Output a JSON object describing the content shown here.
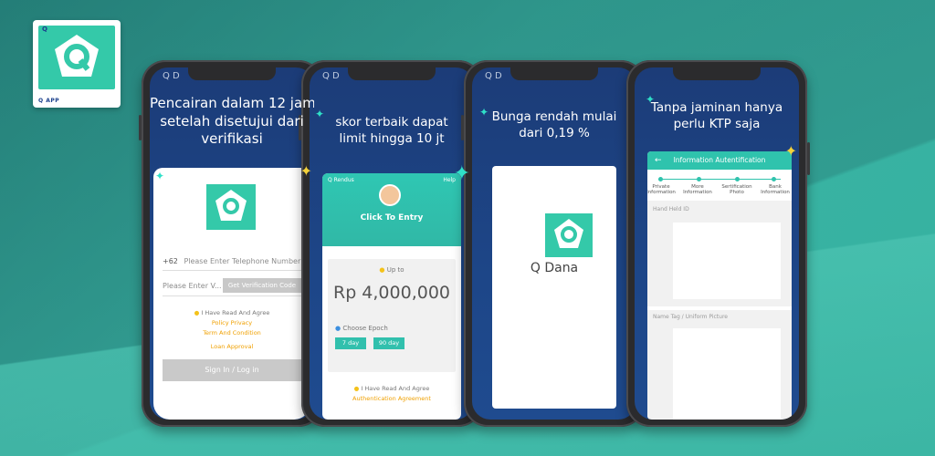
{
  "app_icon": {
    "mini_label": "Q",
    "footer_label": "Q APP"
  },
  "colors": {
    "teal": "#34c9a9",
    "navy": "#1c3c78",
    "star_cyan": "#2fe0c8",
    "star_yellow": "#f4d23a",
    "link_orange": "#f0a000"
  },
  "phone1": {
    "topmark": "Q D",
    "headline_line1": "Pencairan dalam 12 jam",
    "headline_line2": "setelah disetujui dari",
    "headline_line3": "verifikasi",
    "phone_prefix": "+62",
    "phone_placeholder": "Please Enter Telephone Number",
    "code_placeholder": "Please Enter V...",
    "code_button": "Get Verification Code",
    "agree": "I Have Read And Agree",
    "policy_link": "Policy Privacy",
    "terms_link": "Term And Condition",
    "loan_link": "Loan Approval",
    "login_button": "Sign In / Log in"
  },
  "phone2": {
    "topmark": "Q D",
    "headline_line1": "skor terbaik dapat",
    "headline_line2": "limit hingga 10 jt",
    "header_left": "Q Rendus",
    "header_right": "Help",
    "entry_label": "Click To Entry",
    "up_to": "Up to",
    "amount": "Rp 4,000,000",
    "epoch_label": "Choose Epoch",
    "chips": [
      "7 day",
      "90 day"
    ],
    "agree": "I Have Read And Agree",
    "agreement_link": "Authentication Agreement"
  },
  "phone3": {
    "topmark": "Q D",
    "headline_line1": "Bunga rendah mulai",
    "headline_line2": "dari 0,19 %",
    "app_name": "Q Dana"
  },
  "phone4": {
    "headline_line1": "Tanpa jaminan hanya",
    "headline_line2": "perlu KTP saja",
    "back_icon": "←",
    "page_title": "Information Autentification",
    "steps": [
      "Private Information",
      "More Information",
      "Sertification Photo",
      "Bank Information"
    ],
    "section1": "Hand Held ID",
    "section2": "Name Tag / Uniform Picture"
  }
}
